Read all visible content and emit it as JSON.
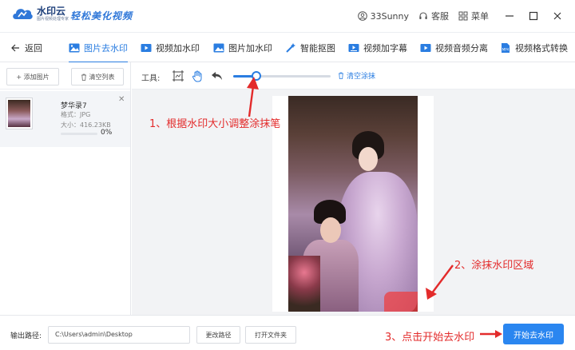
{
  "app": {
    "logo_name": "水印云",
    "logo_sub": "图片视频处理专家",
    "slogan": "轻松美化视频",
    "username": "33Sunny",
    "service": "客服",
    "menu": "菜单"
  },
  "nav": {
    "back": "返回",
    "tabs": [
      {
        "label": "图片去水印",
        "icon": "image-icon",
        "active": true
      },
      {
        "label": "视频加水印",
        "icon": "video-icon"
      },
      {
        "label": "图片加水印",
        "icon": "image-add-icon"
      },
      {
        "label": "智能抠图",
        "icon": "magic-wand-icon"
      },
      {
        "label": "视频加字幕",
        "icon": "video-subtitle-icon"
      },
      {
        "label": "视频音频分离",
        "icon": "video-audio-icon"
      },
      {
        "label": "视频格式转换",
        "icon": "file-convert-icon"
      }
    ]
  },
  "file_panel": {
    "add_label": "+ 添加图片",
    "clear_label": "清空列表",
    "file": {
      "name": "梦华录7",
      "format": "格式：JPG",
      "size": "大小：416.23KB",
      "progress_text": "0%",
      "progress": 0
    }
  },
  "tools": {
    "label": "工具:",
    "brush_size_fraction": 0.24,
    "clear_label": "清空涂抹"
  },
  "annotations": {
    "step1": "1、根据水印大小调整涂抹笔",
    "step2": "2、涂抹水印区域",
    "step3": "3、点击开始去水印"
  },
  "bottom": {
    "output_label": "输出路径:",
    "output_path": "C:\\Users\\admin\\Desktop",
    "change_path": "更改路径",
    "open_folder": "打开文件夹",
    "start": "开始去水印"
  },
  "colors": {
    "accent": "#2a7de1",
    "annotation": "#e32b2b"
  }
}
